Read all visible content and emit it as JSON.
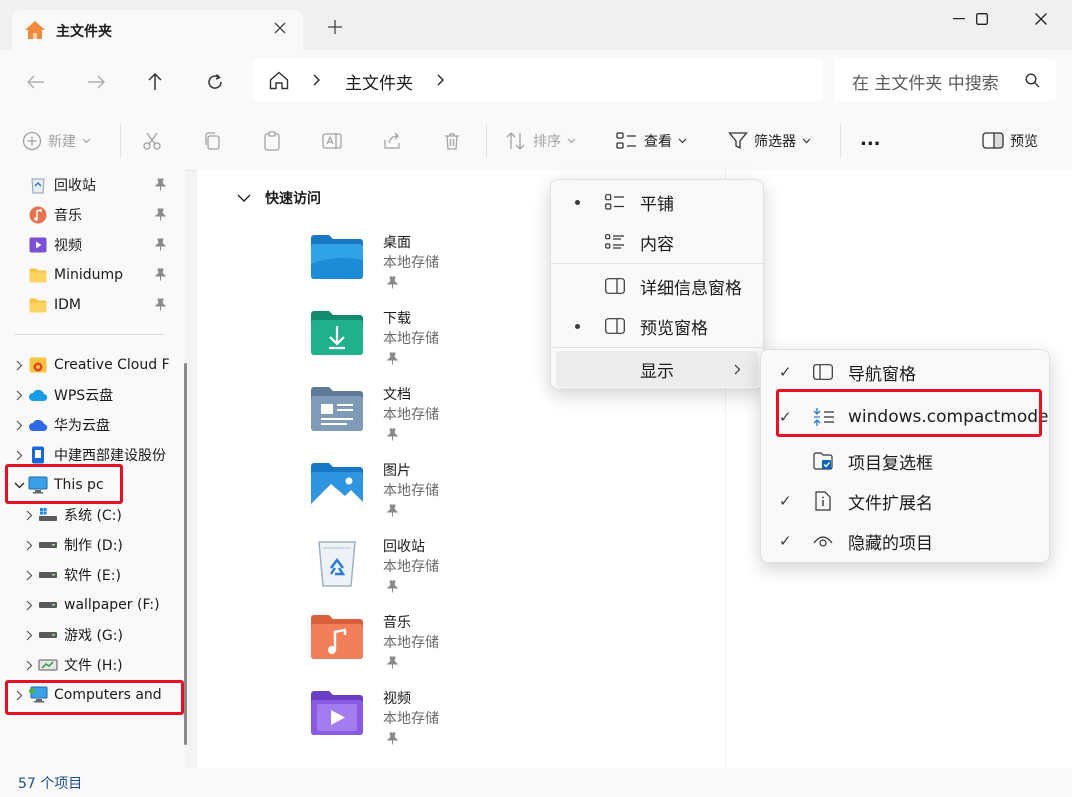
{
  "tab": {
    "title": "主文件夹"
  },
  "address": {
    "segment": "主文件夹"
  },
  "search": {
    "placeholder": "在 主文件夹 中搜索"
  },
  "toolbar": {
    "new_label": "新建",
    "sort_label": "排序",
    "view_label": "查看",
    "filter_label": "筛选器",
    "more_label": "...",
    "preview_label": "预览"
  },
  "sidebar": {
    "pinned": [
      {
        "label": "回收站",
        "icon": "recycle-bin-icon"
      },
      {
        "label": "音乐",
        "icon": "music-icon"
      },
      {
        "label": "视频",
        "icon": "video-icon"
      },
      {
        "label": "Minidump",
        "icon": "folder-icon"
      },
      {
        "label": "IDM",
        "icon": "folder-icon"
      }
    ],
    "locations": [
      {
        "label": "Creative Cloud F",
        "icon": "creative-cloud-icon"
      },
      {
        "label": "WPS云盘",
        "icon": "wps-cloud-icon"
      },
      {
        "label": "华为云盘",
        "icon": "huawei-cloud-icon"
      },
      {
        "label": "中建西部建设股份",
        "icon": "company-drive-icon"
      },
      {
        "label": "This pc",
        "icon": "this-pc-icon"
      },
      {
        "label": "系统 (C:)",
        "icon": "drive-icon"
      },
      {
        "label": "制作 (D:)",
        "icon": "drive-icon"
      },
      {
        "label": "软件 (E:)",
        "icon": "drive-icon"
      },
      {
        "label": "wallpaper (F:)",
        "icon": "drive-icon"
      },
      {
        "label": "游戏 (G:)",
        "icon": "drive-icon"
      },
      {
        "label": "文件 (H:)",
        "icon": "drive-icon"
      },
      {
        "label": "Computers and",
        "icon": "network-computer-icon"
      }
    ]
  },
  "main": {
    "section_title": "快速访问",
    "items": [
      {
        "name": "桌面",
        "sub": "本地存储",
        "icon": "desktop-folder-icon"
      },
      {
        "name": "下载",
        "sub": "本地存储",
        "icon": "downloads-folder-icon"
      },
      {
        "name": "文档",
        "sub": "本地存储",
        "icon": "documents-folder-icon"
      },
      {
        "name": "图片",
        "sub": "本地存储",
        "icon": "pictures-folder-icon"
      },
      {
        "name": "回收站",
        "sub": "本地存储",
        "icon": "recycle-bin-icon"
      },
      {
        "name": "音乐",
        "sub": "本地存储",
        "icon": "music-folder-icon"
      },
      {
        "name": "视频",
        "sub": "本地存储",
        "icon": "videos-folder-icon"
      }
    ]
  },
  "view_menu": {
    "items": [
      {
        "label": "平铺",
        "selected": true
      },
      {
        "label": "内容",
        "selected": false
      },
      {
        "label": "详细信息窗格",
        "selected": false
      },
      {
        "label": "预览窗格",
        "selected": true
      },
      {
        "label": "显示",
        "submenu": true
      }
    ]
  },
  "show_submenu": {
    "items": [
      {
        "label": "导航窗格",
        "checked": true
      },
      {
        "label": "windows.compactmode",
        "checked": true
      },
      {
        "label": "项目复选框",
        "checked": false
      },
      {
        "label": "文件扩展名",
        "checked": true
      },
      {
        "label": "隐藏的项目",
        "checked": true
      }
    ]
  },
  "status": {
    "count": "57 个项目"
  },
  "colors": {
    "highlight_box": "#e81123",
    "accent": "#0067c0"
  }
}
